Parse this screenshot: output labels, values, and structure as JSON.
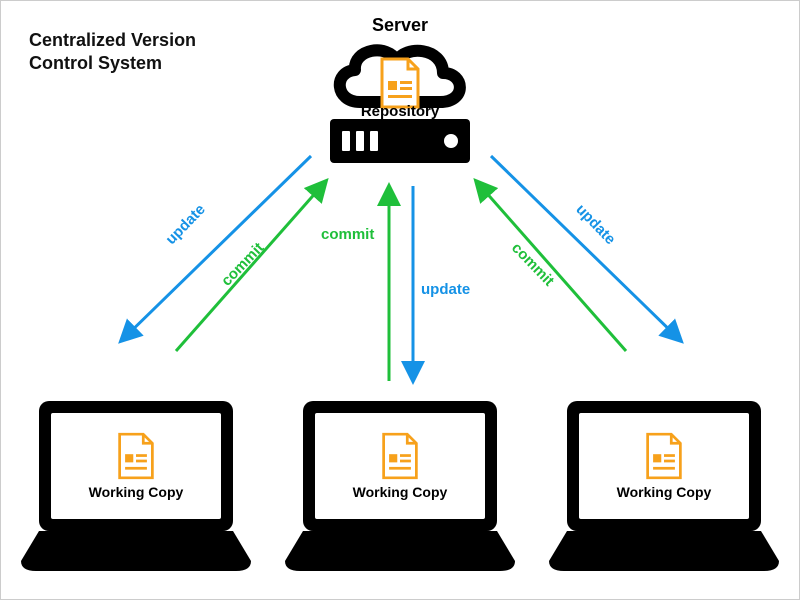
{
  "title": "Centralized Version Control System",
  "server": {
    "label": "Server",
    "repository_label": "Repository"
  },
  "working_copy_label": "Working Copy",
  "edges": {
    "left_update": "update",
    "left_commit": "commit",
    "center_update": "update",
    "center_commit": "commit",
    "right_update": "update",
    "right_commit": "commit"
  },
  "colors": {
    "update": "#1592e6",
    "commit": "#1fbf3a",
    "doc_accent": "#f7a11b"
  }
}
